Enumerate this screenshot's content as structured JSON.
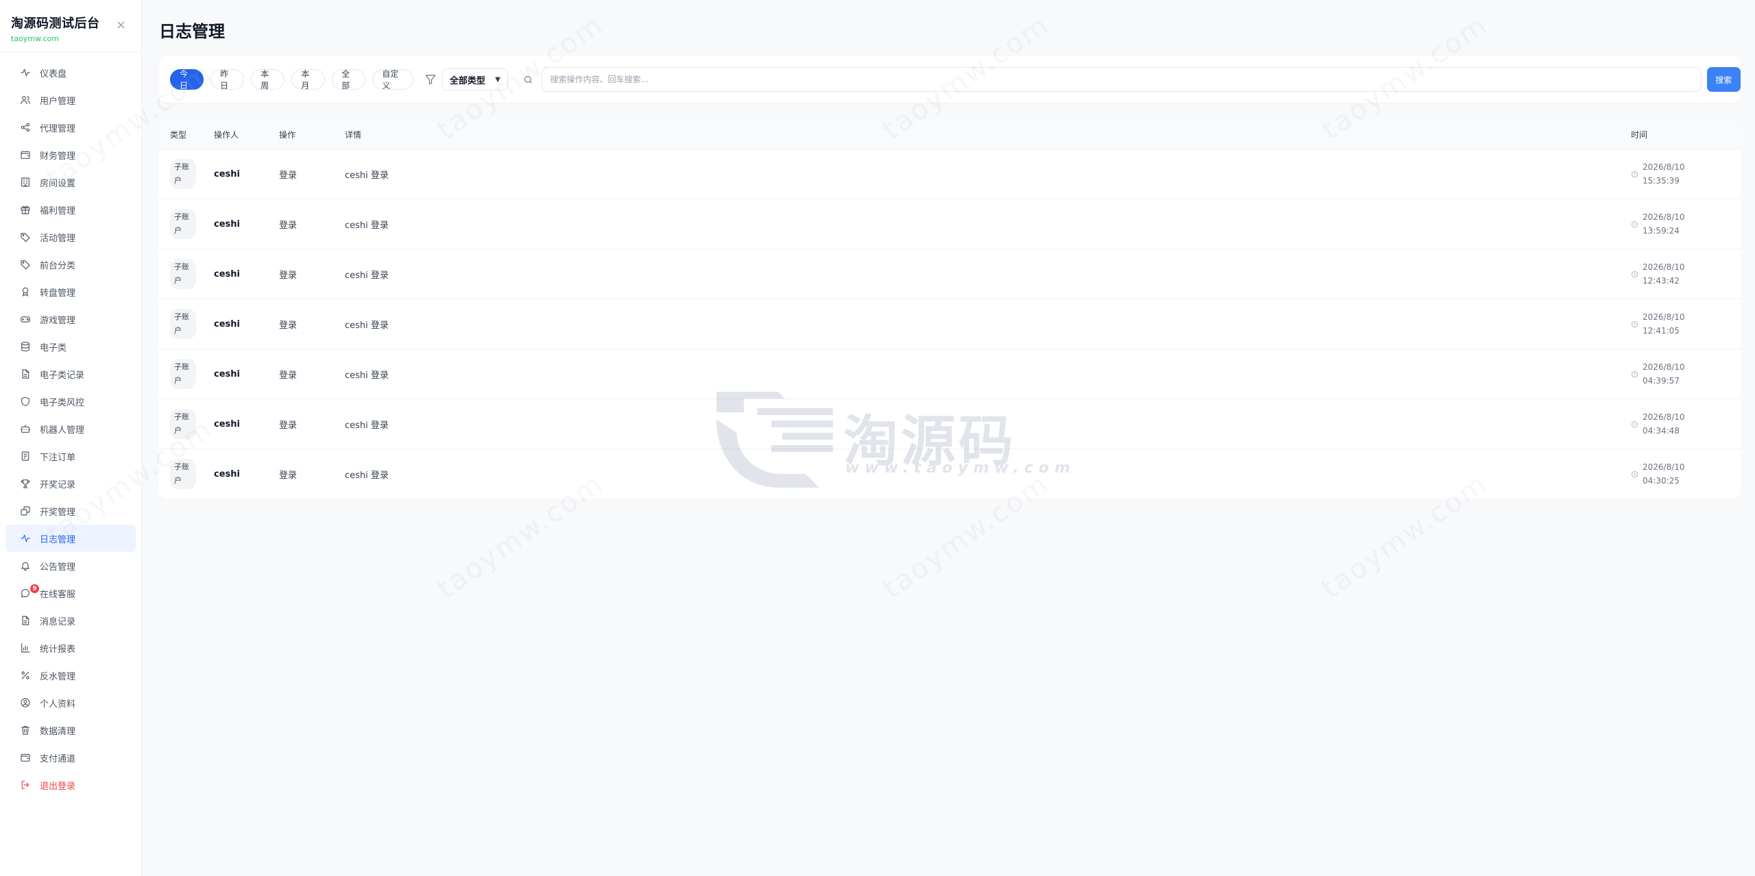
{
  "brand": {
    "title": "淘源码测试后台",
    "subtitle": "taoymw.com",
    "close_icon": "×"
  },
  "sidebar": {
    "items": [
      {
        "label": "仪表盘",
        "icon": "activity-icon"
      },
      {
        "label": "用户管理",
        "icon": "users-icon"
      },
      {
        "label": "代理管理",
        "icon": "share-icon"
      },
      {
        "label": "财务管理",
        "icon": "wallet-icon"
      },
      {
        "label": "房间设置",
        "icon": "building-icon"
      },
      {
        "label": "福利管理",
        "icon": "gift-icon"
      },
      {
        "label": "活动管理",
        "icon": "tag-icon"
      },
      {
        "label": "前台分类",
        "icon": "tag-icon"
      },
      {
        "label": "转盘管理",
        "icon": "award-icon"
      },
      {
        "label": "游戏管理",
        "icon": "gamepad-icon"
      },
      {
        "label": "电子类",
        "icon": "database-icon"
      },
      {
        "label": "电子类记录",
        "icon": "file-icon"
      },
      {
        "label": "电子类风控",
        "icon": "shield-icon"
      },
      {
        "label": "机器人管理",
        "icon": "bot-icon"
      },
      {
        "label": "下注订单",
        "icon": "receipt-icon"
      },
      {
        "label": "开奖记录",
        "icon": "trophy-icon"
      },
      {
        "label": "开奖管理",
        "icon": "dice-icon"
      },
      {
        "label": "日志管理",
        "icon": "activity-icon"
      },
      {
        "label": "公告管理",
        "icon": "bell-icon"
      },
      {
        "label": "在线客服",
        "icon": "chat-icon",
        "badge": "9"
      },
      {
        "label": "消息记录",
        "icon": "file-icon"
      },
      {
        "label": "统计报表",
        "icon": "chart-icon"
      },
      {
        "label": "反水管理",
        "icon": "percent-icon"
      },
      {
        "label": "个人资料",
        "icon": "user-circle-icon"
      },
      {
        "label": "数据清理",
        "icon": "trash-icon"
      },
      {
        "label": "支付通道",
        "icon": "wallet-icon"
      },
      {
        "label": "退出登录",
        "icon": "logout-icon"
      }
    ],
    "active_index": 17
  },
  "page": {
    "title": "日志管理"
  },
  "filters": {
    "chips": [
      "今日",
      "昨日",
      "本周",
      "本月",
      "全部",
      "自定义"
    ],
    "active_chip": "今日",
    "type_select": "全部类型",
    "search_placeholder": "搜索操作内容、回车搜索...",
    "search_value": "",
    "search_button": "搜索"
  },
  "table": {
    "headers": {
      "type": "类型",
      "operator": "操作人",
      "action": "操作",
      "detail": "详情",
      "time": "时间"
    },
    "rows": [
      {
        "type": "子账户",
        "operator": "ceshi",
        "action": "登录",
        "detail": "ceshi 登录",
        "date": "2026/8/10",
        "time": "15:35:39"
      },
      {
        "type": "子账户",
        "operator": "ceshi",
        "action": "登录",
        "detail": "ceshi 登录",
        "date": "2026/8/10",
        "time": "13:59:24"
      },
      {
        "type": "子账户",
        "operator": "ceshi",
        "action": "登录",
        "detail": "ceshi 登录",
        "date": "2026/8/10",
        "time": "12:43:42"
      },
      {
        "type": "子账户",
        "operator": "ceshi",
        "action": "登录",
        "detail": "ceshi 登录",
        "date": "2026/8/10",
        "time": "12:41:05"
      },
      {
        "type": "子账户",
        "operator": "ceshi",
        "action": "登录",
        "detail": "ceshi 登录",
        "date": "2026/8/10",
        "time": "04:39:57"
      },
      {
        "type": "子账户",
        "operator": "ceshi",
        "action": "登录",
        "detail": "ceshi 登录",
        "date": "2026/8/10",
        "time": "04:34:48"
      },
      {
        "type": "子账户",
        "operator": "ceshi",
        "action": "登录",
        "detail": "ceshi 登录",
        "date": "2026/8/10",
        "time": "04:30:25"
      }
    ]
  },
  "watermark": {
    "text": "taoymw.com",
    "logo_text": "淘源码",
    "logo_url": "www.taoymw.com"
  },
  "colors": {
    "accent": "#2563eb",
    "danger": "#ef4444",
    "brand_sub": "#22c55e"
  }
}
